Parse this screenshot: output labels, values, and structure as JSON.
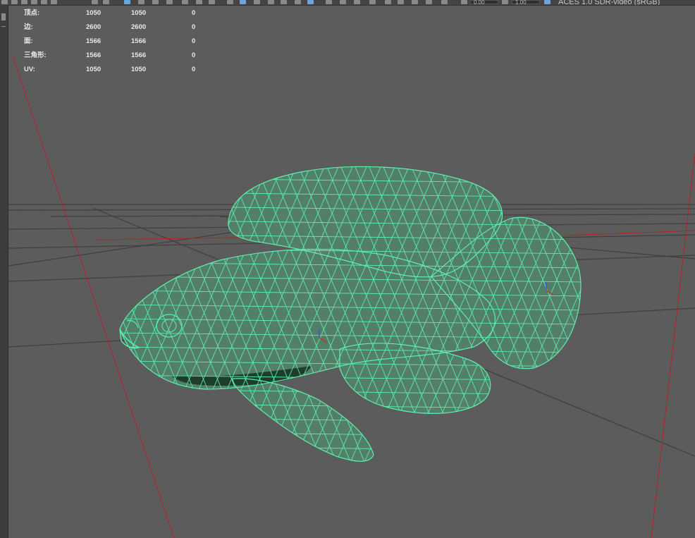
{
  "toolbar": {
    "exposure_value": "0.00",
    "gamma_value": "1.00",
    "color_management_label": "ACES 1.0 SDR-video (sRGB)"
  },
  "heads_up_display": {
    "rows": [
      {
        "label": "顶点:",
        "count": "1050",
        "selected": "1050",
        "extra": "0"
      },
      {
        "label": "边:",
        "count": "2600",
        "selected": "2600",
        "extra": "0"
      },
      {
        "label": "面:",
        "count": "1566",
        "selected": "1566",
        "extra": "0"
      },
      {
        "label": "三角形:",
        "count": "1566",
        "selected": "1566",
        "extra": "0"
      },
      {
        "label": "UV:",
        "count": "1050",
        "selected": "1050",
        "extra": "0"
      }
    ]
  },
  "colors": {
    "viewport_bg": "#5c5c5c",
    "grid_line": "#3f3f3f",
    "axis_red": "#b8202a",
    "wireframe": "#5cf0b0",
    "mesh_fill": "#537f68",
    "mesh_shadow": "#1f3d2c"
  },
  "viewport": {
    "object": "fish-mesh",
    "display_mode": "wireframe-on-shaded"
  }
}
